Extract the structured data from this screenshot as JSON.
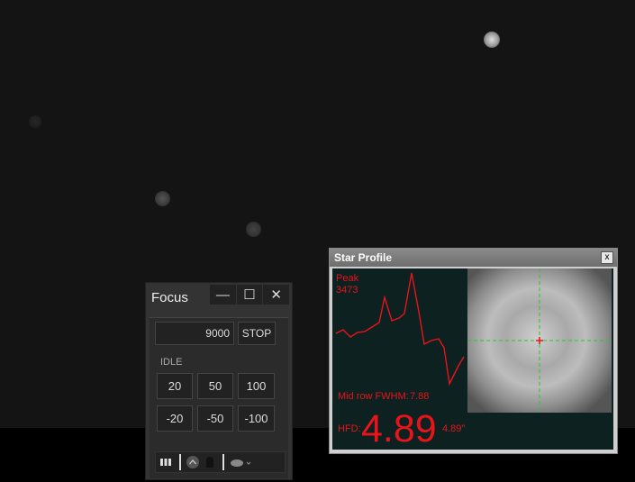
{
  "focus": {
    "title": "Focus",
    "position_value": "9000",
    "stop_label": "STOP",
    "status": "IDLE",
    "steps_positive": [
      "20",
      "50",
      "100"
    ],
    "steps_negative": [
      "-20",
      "-50",
      "-100"
    ]
  },
  "star_profile": {
    "title": "Star Profile",
    "close_label": "x",
    "peak_label": "Peak",
    "peak_value": "3473",
    "fwhm_label": "Mid row FWHM:",
    "fwhm_value": "7.88",
    "hfd_label": "HFD:",
    "hfd_value": "4.89",
    "hfd_arcsec": "4.89\""
  },
  "colors": {
    "profile_line": "#e8141a",
    "crosshair": "#22cc22",
    "background": "#141414"
  }
}
